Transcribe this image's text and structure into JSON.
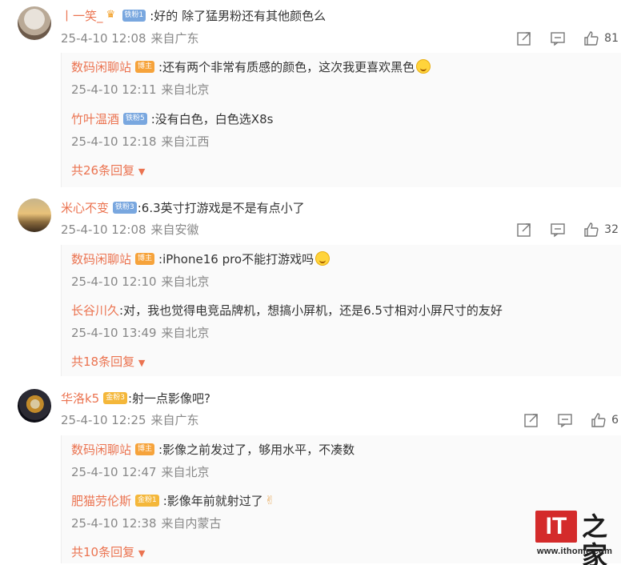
{
  "comments": [
    {
      "user": "丨一笑_",
      "badge": "铁粉1",
      "text": ":好的 除了猛男粉还有其他颜色么",
      "date": "25-4-10 12:08",
      "location": "来自广东",
      "likes": "81",
      "replies": [
        {
          "user": "数码闲聊站",
          "badge": "博主",
          "text": ":还有两个非常有质感的颜色，这次我更喜欢黑色",
          "emoji": "smile-icon",
          "date": "25-4-10 12:11",
          "location": "来自北京"
        },
        {
          "user": "竹叶温酒",
          "badge": "铁粉5",
          "text": ":没有白色，白色选X8s",
          "date": "25-4-10 12:18",
          "location": "来自江西"
        }
      ],
      "more": "共26条回复"
    },
    {
      "user": "米心不变",
      "badge": "铁粉3",
      "text": ":6.3英寸打游戏是不是有点小了",
      "date": "25-4-10 12:08",
      "location": "来自安徽",
      "likes": "32",
      "replies": [
        {
          "user": "数码闲聊站",
          "badge": "博主",
          "text": ":iPhone16 pro不能打游戏吗",
          "emoji": "smile-icon",
          "date": "25-4-10 12:10",
          "location": "来自北京"
        },
        {
          "user": "长谷川久",
          "text": ":对，我也觉得电竞品牌机，想搞小屏机，还是6.5寸相对小屏尺寸的友好",
          "date": "25-4-10 13:49",
          "location": "来自北京"
        }
      ],
      "more": "共18条回复"
    },
    {
      "user": "华洛k5",
      "badge": "金粉3",
      "text": ":射一点影像吧?",
      "date": "25-4-10 12:25",
      "location": "来自广东",
      "likes": "6",
      "replies": [
        {
          "user": "数码闲聊站",
          "badge": "博主",
          "text": ":影像之前发过了，够用水平，不凑数",
          "date": "25-4-10 12:47",
          "location": "来自北京"
        },
        {
          "user": "肥猫劳伦斯",
          "badge": "金粉1",
          "text": ":影像年前就射过了",
          "emoji": "victory-hand-icon",
          "date": "25-4-10 12:38",
          "location": "来自内蒙古"
        }
      ],
      "more": "共10条回复"
    }
  ],
  "watermark": {
    "brand": "IT之家",
    "it": "IT",
    "zh": "之家",
    "url": "www.ithome.com"
  },
  "colors": {
    "name": "#eb7350",
    "meta": "#888888",
    "fan_badge": "#79a7df",
    "gold_badge": "#f4b73a",
    "host_badge": "#f6a33b"
  }
}
